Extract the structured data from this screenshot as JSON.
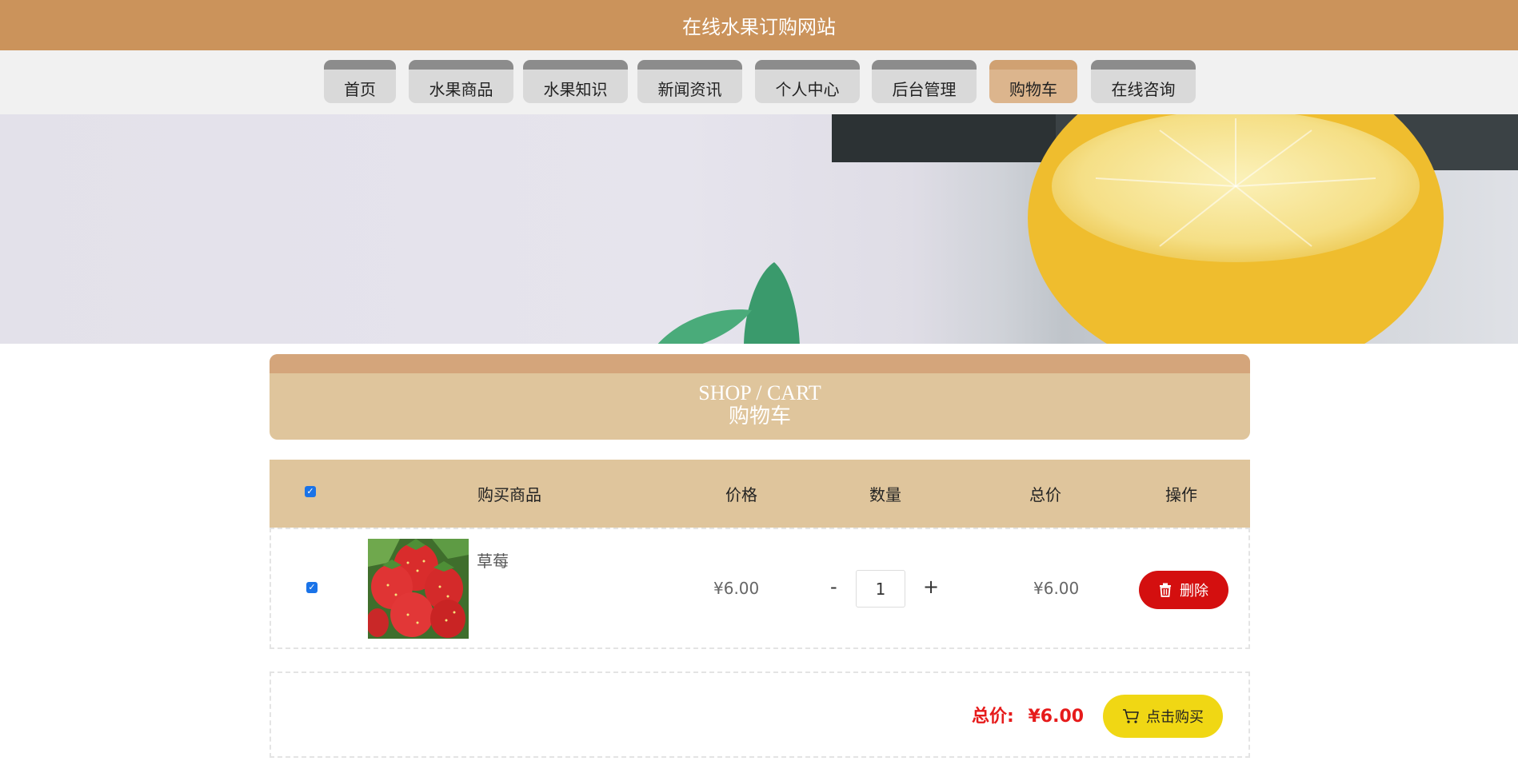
{
  "site": {
    "title": "在线水果订购网站"
  },
  "nav": {
    "items": [
      {
        "label": "首页"
      },
      {
        "label": "水果商品"
      },
      {
        "label": "水果知识"
      },
      {
        "label": "新闻资讯"
      },
      {
        "label": "个人中心"
      },
      {
        "label": "后台管理"
      },
      {
        "label": "购物车",
        "active": true
      },
      {
        "label": "在线咨询"
      }
    ]
  },
  "section": {
    "title_en": "SHOP / CART",
    "title_cn": "购物车"
  },
  "cart": {
    "headers": {
      "product": "购买商品",
      "price": "价格",
      "quantity": "数量",
      "total": "总价",
      "action": "操作"
    },
    "select_all_checked": true,
    "items": [
      {
        "checked": true,
        "name": "草莓",
        "price": "¥6.00",
        "quantity": "1",
        "total": "¥6.00",
        "decrement": "-",
        "increment": "+",
        "delete_label": "删除"
      }
    ]
  },
  "summary": {
    "total_label": "总价:",
    "total_value": "¥6.00",
    "buy_label": "点击购买"
  },
  "colors": {
    "header_bg": "#cb935b",
    "nav_active": "#dcb58d",
    "section_bg": "#dfc59c",
    "delete_button": "#d40f0f",
    "buy_button": "#f0d714",
    "total_text": "#e61b1b"
  },
  "icons": {
    "delete": "trash-icon",
    "buy": "cart-icon",
    "checkbox": "checkmark-icon"
  }
}
